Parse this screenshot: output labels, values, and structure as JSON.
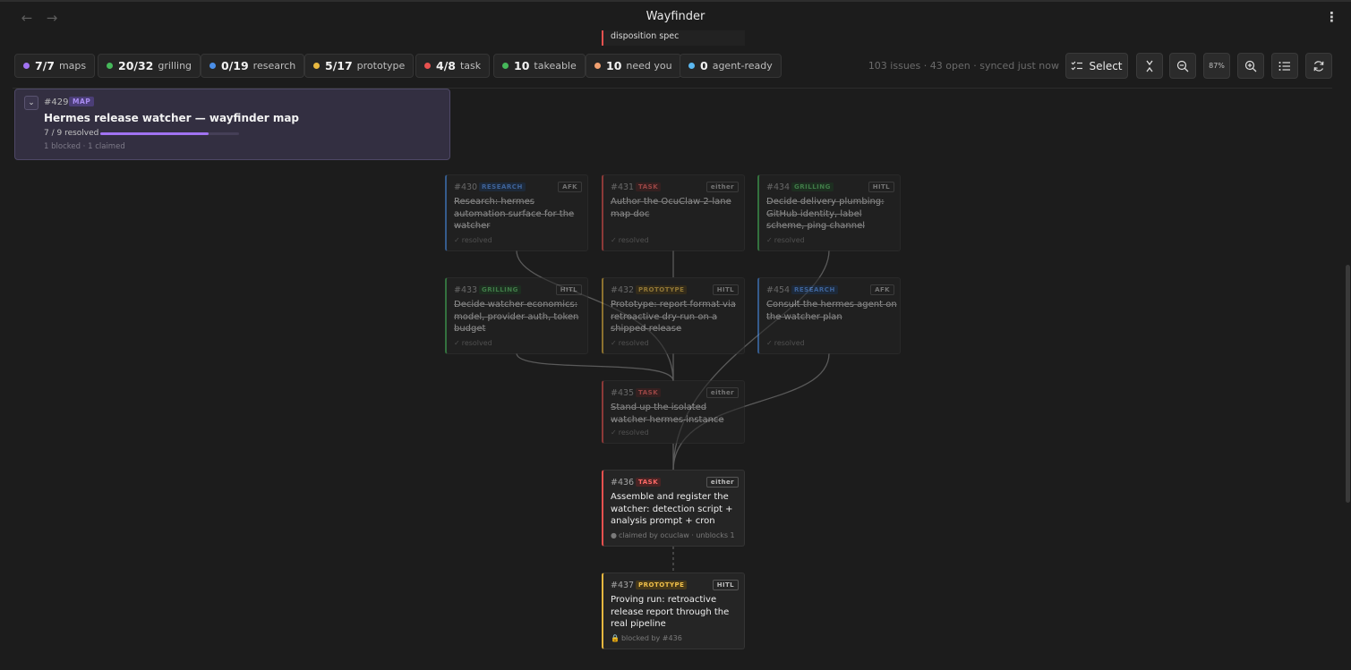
{
  "app": {
    "title": "Wayfinder"
  },
  "chips": [
    {
      "count": "7/7",
      "label": "maps",
      "color": "#a173f2"
    },
    {
      "count": "20/32",
      "label": "grilling",
      "color": "#46b85a"
    },
    {
      "count": "0/19",
      "label": "research",
      "color": "#4b8fe8"
    },
    {
      "count": "5/17",
      "label": "prototype",
      "color": "#e8b840"
    },
    {
      "count": "4/8",
      "label": "task",
      "color": "#e8514f"
    },
    {
      "count": "10",
      "label": "takeable",
      "color": "#46b85a"
    },
    {
      "count": "10",
      "label": "need you",
      "color": "#f0a070"
    },
    {
      "count": "0",
      "label": "agent-ready",
      "color": "#5bb8f0"
    }
  ],
  "status_text": "103 issues · 43 open · synced just now",
  "toolbar": {
    "select_label": "Select",
    "zoom_label": "87%"
  },
  "peek_card": {
    "title": "disposition spec"
  },
  "map": {
    "number": "#429",
    "tag": "MAP",
    "title": "Hermes release watcher — wayfinder map",
    "resolved_text": "7 / 9 resolved",
    "progress": 0.78,
    "sub": "1 blocked · 1 claimed"
  },
  "cards": [
    {
      "num": "#430",
      "tag": "RESEARCH",
      "mode": "AFK",
      "title": "Research: hermes automation surface for the watcher",
      "status": "resolved",
      "status_icon": "✓"
    },
    {
      "num": "#431",
      "tag": "TASK",
      "mode": "either",
      "title": "Author the OcuClaw 2-lane map doc",
      "status": "resolved",
      "status_icon": "✓"
    },
    {
      "num": "#434",
      "tag": "GRILLING",
      "mode": "HITL",
      "title": "Decide delivery plumbing: GitHub identity, label scheme, ping channel",
      "status": "resolved",
      "status_icon": "✓"
    },
    {
      "num": "#433",
      "tag": "GRILLING",
      "mode": "HITL",
      "title": "Decide watcher economics: model, provider auth, token budget",
      "status": "resolved",
      "status_icon": "✓"
    },
    {
      "num": "#432",
      "tag": "PROTOTYPE",
      "mode": "HITL",
      "title": "Prototype: report format via retroactive dry-run on a shipped release",
      "status": "resolved",
      "status_icon": "✓"
    },
    {
      "num": "#454",
      "tag": "RESEARCH",
      "mode": "AFK",
      "title": "Consult the hermes agent on the watcher plan",
      "status": "resolved",
      "status_icon": "✓"
    },
    {
      "num": "#435",
      "tag": "TASK",
      "mode": "either",
      "title": "Stand up the isolated watcher hermes instance",
      "status": "resolved",
      "status_icon": "✓"
    },
    {
      "num": "#436",
      "tag": "TASK",
      "mode": "either",
      "title": "Assemble and register the watcher: detection script + analysis prompt + cron",
      "status": "claimed by ocuclaw · unblocks 1",
      "status_icon": "●"
    },
    {
      "num": "#437",
      "tag": "PROTOTYPE",
      "mode": "HITL",
      "title": "Proving run: retroactive release report through the real pipeline",
      "status": "blocked by #436",
      "status_icon": "🔒"
    }
  ]
}
